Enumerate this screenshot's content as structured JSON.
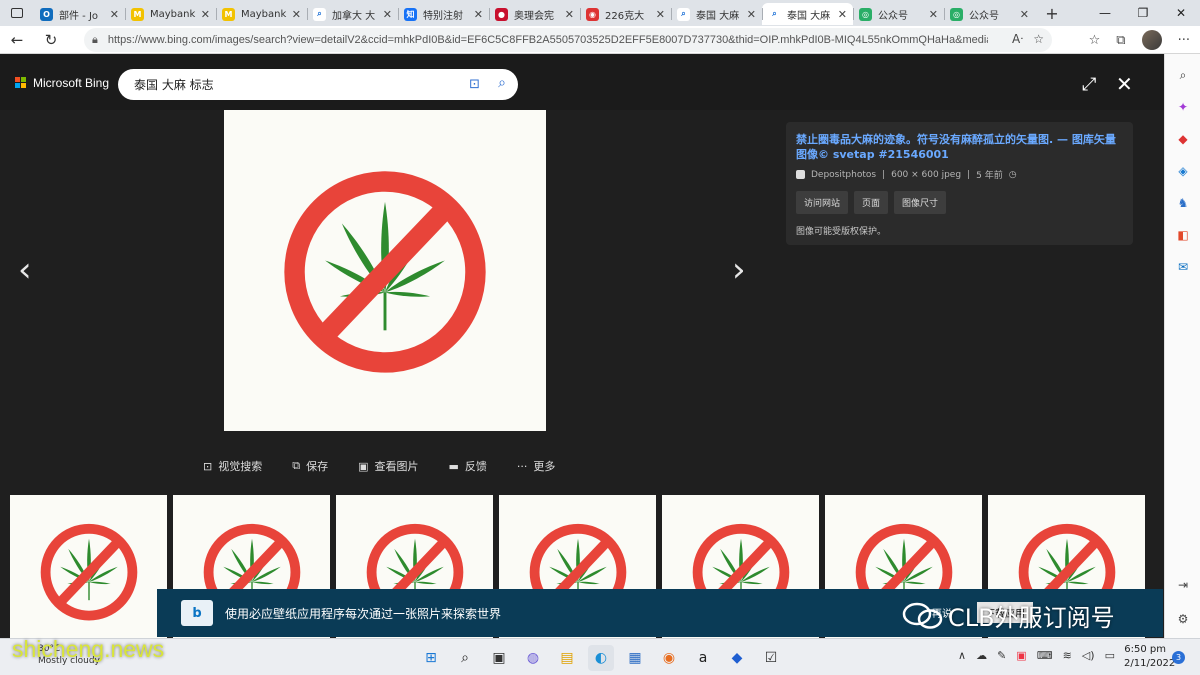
{
  "tabs": [
    {
      "label": "部件 - Jo",
      "icon": "outlook-icon",
      "color": "#0f6cbd",
      "glyph": "O"
    },
    {
      "label": "Maybank",
      "icon": "maybank-icon",
      "color": "#f2c200",
      "glyph": "M"
    },
    {
      "label": "Maybank",
      "icon": "maybank-icon",
      "color": "#f2c200",
      "glyph": "M"
    },
    {
      "label": "加拿大 大",
      "icon": "search-icon",
      "color": "#ffffff",
      "glyph": "⌕"
    },
    {
      "label": "特别注射",
      "icon": "zhihu-icon",
      "color": "#1772f6",
      "glyph": "知"
    },
    {
      "label": "奥理会宪",
      "icon": "site-icon",
      "color": "#c8102e",
      "glyph": "●"
    },
    {
      "label": "226克大",
      "icon": "site-icon",
      "color": "#d33",
      "glyph": "◉"
    },
    {
      "label": "泰国 大麻",
      "icon": "search-icon",
      "color": "#ffffff",
      "glyph": "⌕"
    },
    {
      "label": "泰国 大麻",
      "icon": "search-icon",
      "color": "#ffffff",
      "glyph": "⌕",
      "active": true
    },
    {
      "label": "公众号",
      "icon": "wechat-icon",
      "color": "#2aae67",
      "glyph": "◎"
    },
    {
      "label": "公众号",
      "icon": "wechat-icon",
      "color": "#2aae67",
      "glyph": "◎"
    }
  ],
  "address": {
    "url": "https://www.bing.com/images/search?view=detailV2&ccid=mhkPdI0B&id=EF6C5C8FFB2A5505703525D2EFF5E8007D737730&thid=OIP.mhkPdI0B-MIQ4L55nkOmmQHaHa&media..."
  },
  "bing": {
    "logo": "Microsoft Bing",
    "query": "泰国 大麻 标志"
  },
  "info": {
    "title": "禁止圈毒品大麻的迹象。符号没有麻醉孤立的矢量图. — 图库矢量图像© svetap #21546001",
    "source": "Depositphotos",
    "dims": "600 × 600 jpeg",
    "age": "5 年前",
    "btn_visit": "访问网站",
    "btn_page": "页面",
    "btn_size": "图像尺寸",
    "copyright": "图像可能受版权保护。"
  },
  "actions": {
    "visual_search": "视觉搜索",
    "save": "保存",
    "view_image": "查看图片",
    "feedback": "反馈",
    "more": "更多"
  },
  "banner": {
    "text": "使用必应壁纸应用程序每次通过一张照片来探索世界",
    "btn_later": "再说",
    "btn_download": "下载应用"
  },
  "overlay": {
    "wechat": "CLB外服订阅号",
    "watermark": "shicheng.news"
  },
  "taskbar": {
    "weather_temp": "30°C",
    "weather_desc": "Mostly cloudy",
    "time": "6:50 pm",
    "date": "2/11/2022",
    "notifications": "3"
  },
  "colors": {
    "accent": "#2f6fd1",
    "link": "#6aa9ff",
    "banner": "#0a3b56",
    "prohibit_red": "#e8443a",
    "leaf_green": "#2e8b2e"
  }
}
